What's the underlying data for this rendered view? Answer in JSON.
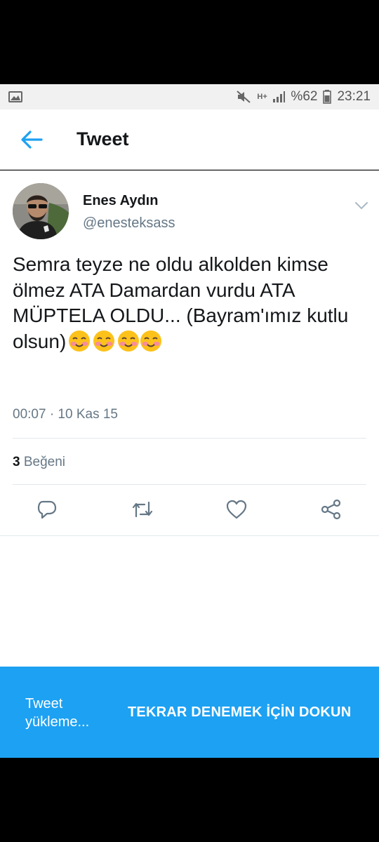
{
  "status_bar": {
    "battery": "%62",
    "time": "23:21",
    "network": "H+",
    "icons": [
      "gallery-icon",
      "mute-icon",
      "network-icon",
      "signal-icon",
      "battery-icon"
    ]
  },
  "app_bar": {
    "title": "Tweet",
    "back_icon": "arrow-left-icon",
    "accent_color": "#1da1f2"
  },
  "tweet": {
    "author_name": "Enes Aydın",
    "author_handle": "@enesteksass",
    "text": "Semra teyze ne oldu alkolden kimse ölmez ATA Damardan vurdu ATA MÜPTELA OLDU... (Bayram'ımız kutlu olsun)",
    "emoji_count": 4,
    "emoji": "smiling-face-icon",
    "timestamp": "00:07 · 10 Kas 15",
    "likes_count": "3",
    "likes_label": "Beğeni",
    "actions": [
      "reply-icon",
      "retweet-icon",
      "like-icon",
      "share-icon"
    ]
  },
  "snackbar": {
    "message": "Tweet yükleme...",
    "action": "TEKRAR DENEMEK İÇİN DOKUN",
    "background": "#1da1f2"
  }
}
